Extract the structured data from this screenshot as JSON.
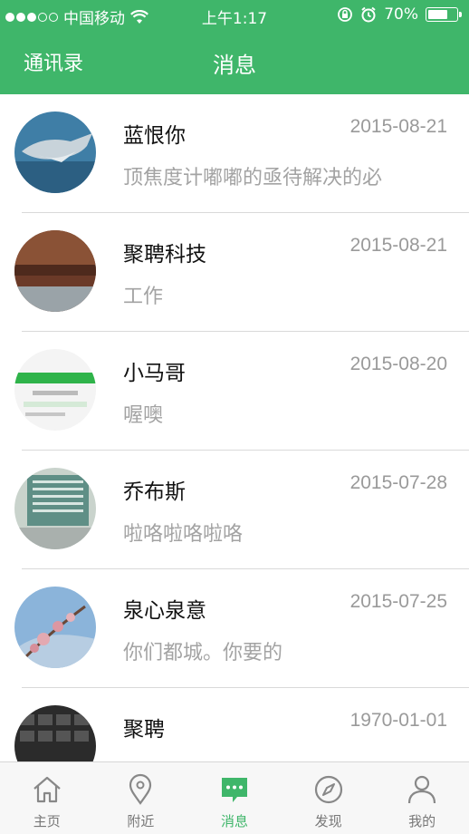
{
  "status_bar": {
    "carrier": "中国移动",
    "time": "上午1:17",
    "battery": "70%",
    "battery_level": 0.7
  },
  "nav": {
    "left_label": "通讯录",
    "title": "消息"
  },
  "messages": [
    {
      "name": "蓝恨你",
      "date": "2015-08-21",
      "preview": "顶焦度计嘟嘟的亟待解决的必"
    },
    {
      "name": "聚聘科技",
      "date": "2015-08-21",
      "preview": "工作"
    },
    {
      "name": "小马哥",
      "date": "2015-08-20",
      "preview": "喔噢"
    },
    {
      "name": "乔布斯",
      "date": "2015-07-28",
      "preview": "啦咯啦咯啦咯"
    },
    {
      "name": "泉心泉意",
      "date": "2015-07-25",
      "preview": "你们都城。你要的"
    },
    {
      "name": "聚聘",
      "date": "1970-01-01",
      "preview": ""
    }
  ],
  "tabs": [
    {
      "label": "主页",
      "icon": "home-icon"
    },
    {
      "label": "附近",
      "icon": "location-pin-icon"
    },
    {
      "label": "消息",
      "icon": "chat-bubble-icon",
      "active": true
    },
    {
      "label": "发现",
      "icon": "compass-icon"
    },
    {
      "label": "我的",
      "icon": "person-icon"
    }
  ],
  "colors": {
    "accent": "#3fb66a",
    "date_text": "#9a9a9a",
    "preview_text": "#a3a3a3"
  }
}
